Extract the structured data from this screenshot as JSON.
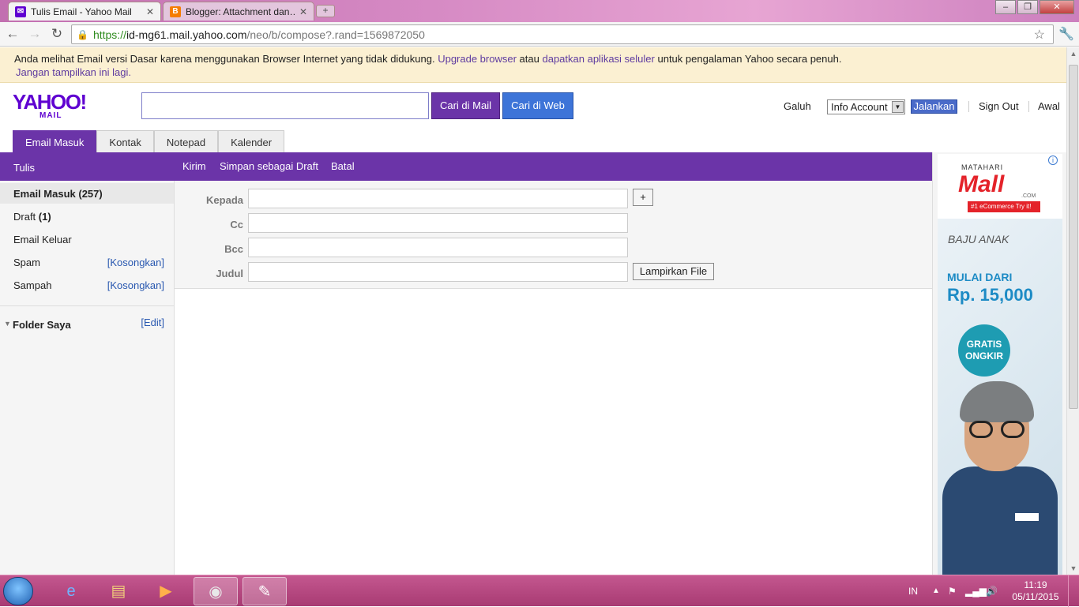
{
  "browser": {
    "tabs": [
      {
        "title": "Tulis Email - Yahoo Mail",
        "favicon": "yahoo-mail-icon"
      },
      {
        "title": "Blogger: Attachment dan…",
        "favicon": "blogger-icon"
      }
    ],
    "url": {
      "protocol": "https://",
      "host": "id-mg61.mail.yahoo.com",
      "path": "/neo/b/compose?.rand=1569872050"
    }
  },
  "notice": {
    "text_before": "Anda melihat Email versi Dasar karena menggunakan Browser Internet yang tidak didukung.",
    "upgrade_link": "Upgrade browser",
    "text_or": "atau",
    "app_link": "dapatkan aplikasi seluler",
    "text_after": "untuk pengalaman Yahoo secara penuh.",
    "dismiss_link": "Jangan tampilkan ini lagi."
  },
  "header": {
    "logo_text": "YAHOO!",
    "logo_sub": "MAIL",
    "search_mail_label": "Cari di Mail",
    "search_web_label": "Cari di Web",
    "user_name": "Galuh",
    "account_select": "Info Account",
    "go_label": "Jalankan",
    "signout_label": "Sign Out",
    "home_label": "Awal"
  },
  "nav_tabs": [
    "Email Masuk",
    "Kontak",
    "Notepad",
    "Kalender"
  ],
  "action_bar": {
    "compose": "Tulis",
    "send": "Kirim",
    "save_draft": "Simpan sebagai Draft",
    "cancel": "Batal"
  },
  "folders": {
    "inbox": "Email Masuk (257)",
    "draft": "Draft",
    "draft_count": "(1)",
    "sent": "Email Keluar",
    "spam": "Spam",
    "trash": "Sampah",
    "empty_label": "[Kosongkan]",
    "my_folders": "Folder Saya",
    "edit_label": "[Edit]"
  },
  "compose": {
    "to_label": "Kepada",
    "cc_label": "Cc",
    "bcc_label": "Bcc",
    "subject_label": "Judul",
    "plus_label": "+",
    "attach_label": "Lampirkan File"
  },
  "ad": {
    "brand_small": "MATAHARI",
    "brand": "Mall",
    "brand_com": ".COM",
    "badge": "#1 eCommerce  Try it!",
    "category": "BAJU ANAK",
    "from_label": "MULAI DARI",
    "price": "Rp. 15,000",
    "promo_line1": "GRATIS",
    "promo_line2": "ONGKIR"
  },
  "taskbar": {
    "lang": "IN",
    "time": "11:19",
    "date": "05/11/2015"
  }
}
